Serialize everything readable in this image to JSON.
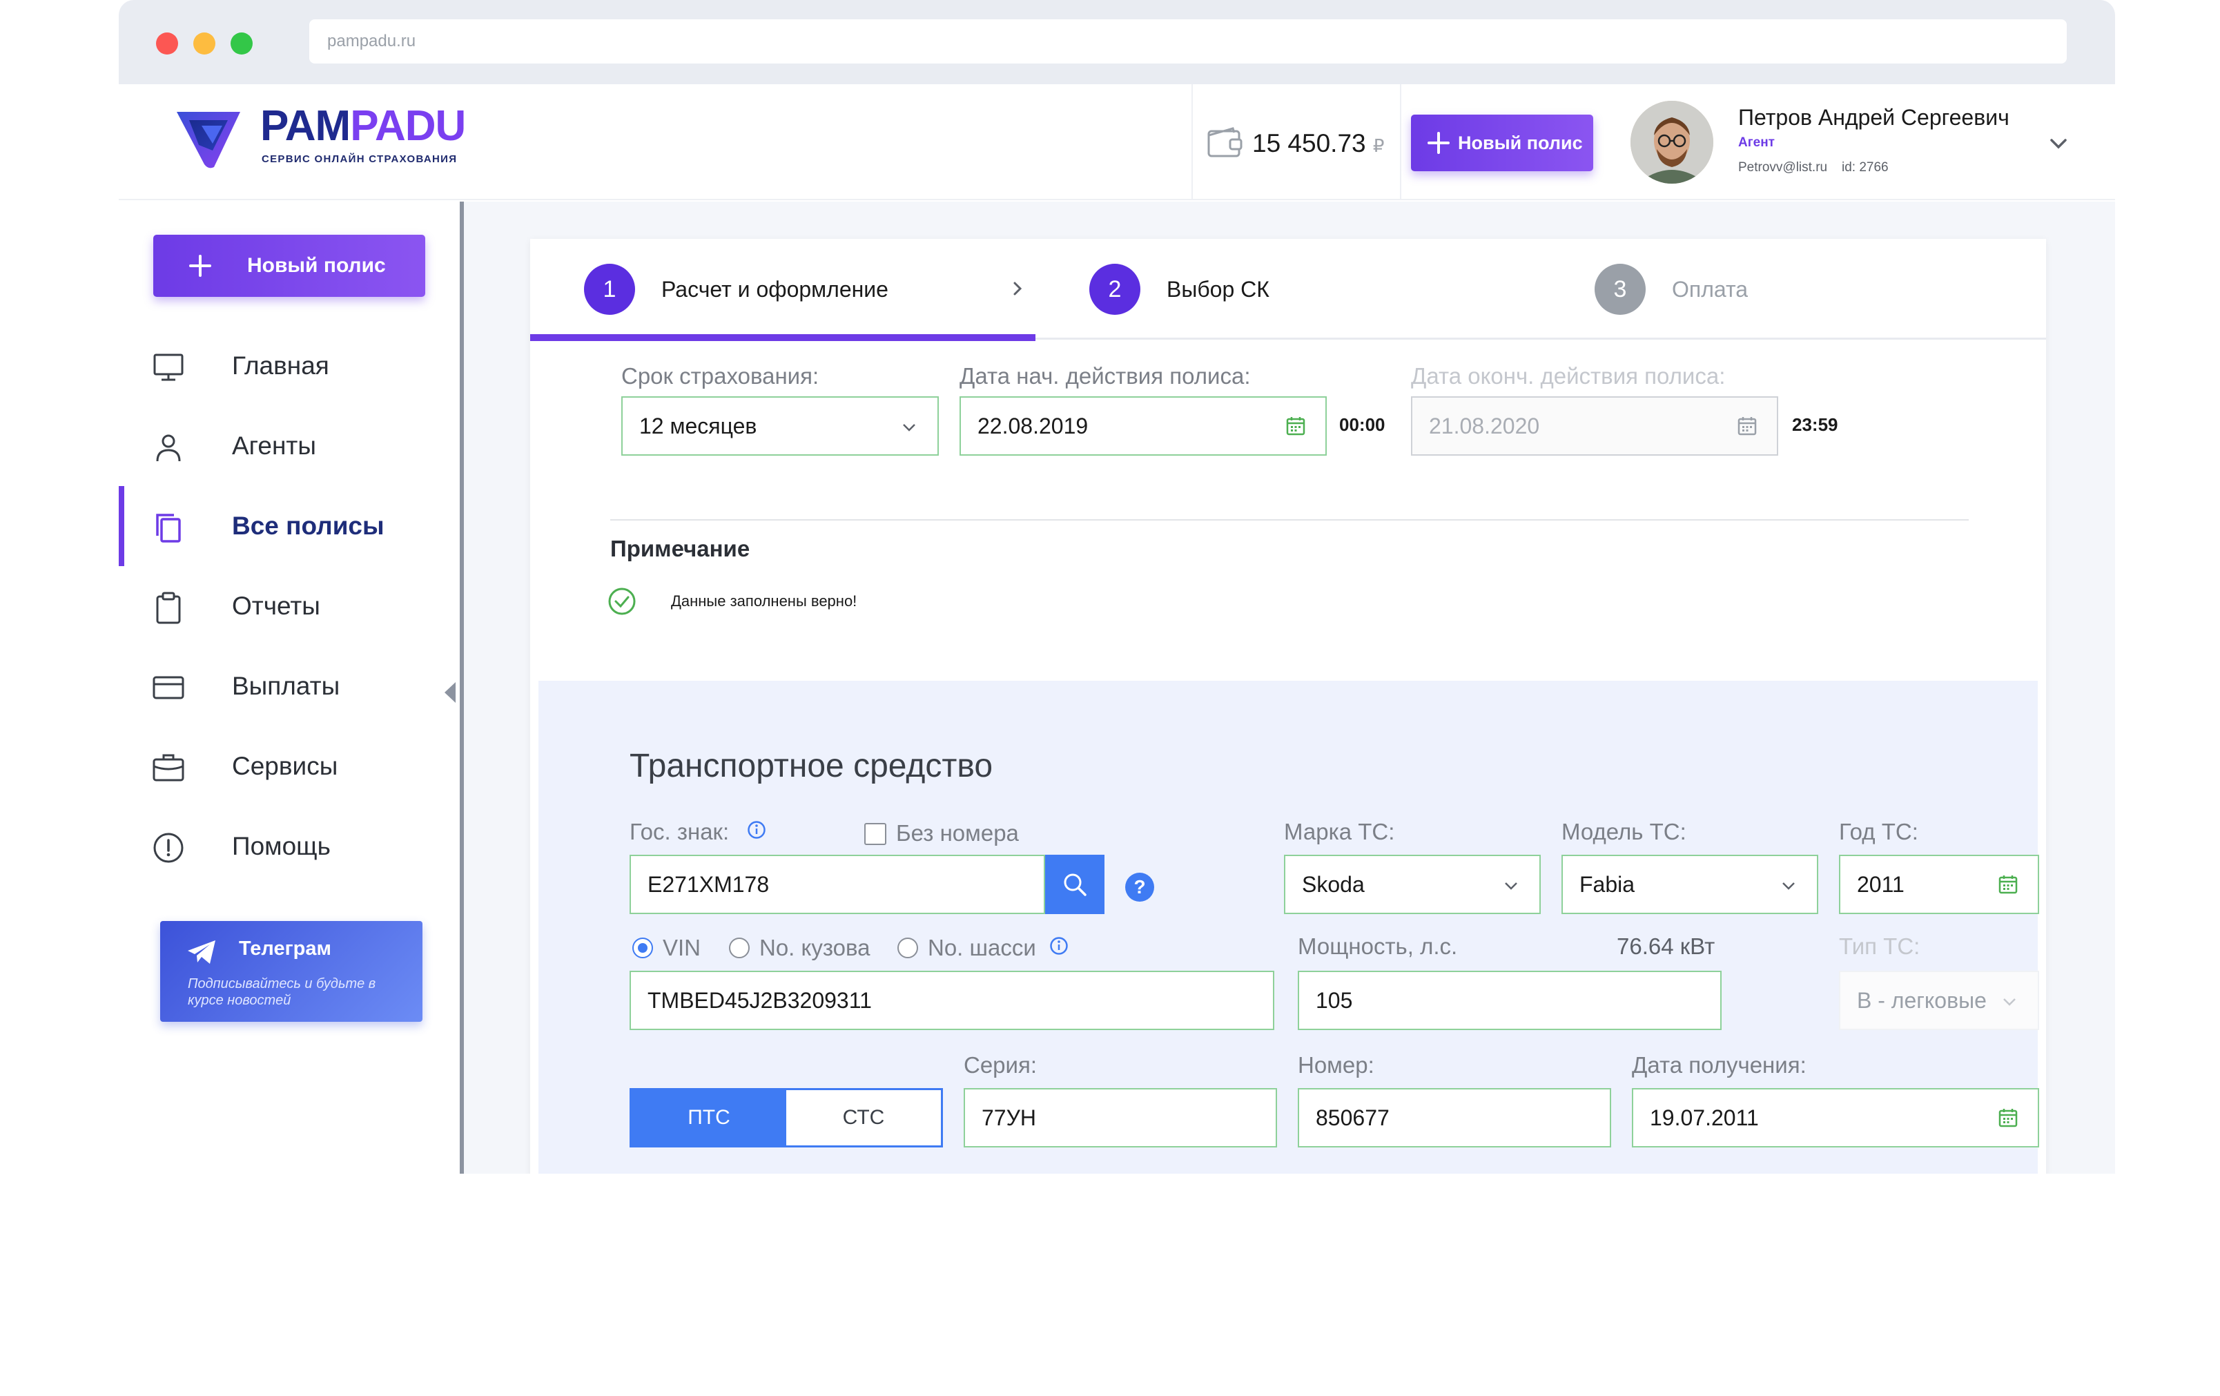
{
  "browser": {
    "url": "pampadu.ru"
  },
  "brand": {
    "name_part1": "PAM",
    "name_part2": "PADU",
    "tagline": "СЕРВИС ОНЛАЙН СТРАХОВАНИЯ",
    "color_dark": "#1f2a8f",
    "color_purple": "#7a3ff0"
  },
  "header": {
    "balance": "15 450.73",
    "currency": "₽",
    "new_policy_label": "Новый полис",
    "user": {
      "name": "Петров Андрей Сергеевич",
      "role": "Агент",
      "email": "Petrovv@list.ru",
      "id_label": "id: 2766"
    }
  },
  "sidebar": {
    "new_policy_label": "Новый полис",
    "items": [
      {
        "label": "Главная",
        "icon": "monitor-icon"
      },
      {
        "label": "Агенты",
        "icon": "user-icon"
      },
      {
        "label": "Все полисы",
        "icon": "copy-icon",
        "active": true
      },
      {
        "label": "Отчеты",
        "icon": "clipboard-icon"
      },
      {
        "label": "Выплаты",
        "icon": "card-icon"
      },
      {
        "label": "Сервисы",
        "icon": "briefcase-icon"
      },
      {
        "label": "Помощь",
        "icon": "alert-circle-icon"
      }
    ],
    "telegram": {
      "title": "Телеграм",
      "subtitle_line1": "Подписывайтесь и будьте в",
      "subtitle_line2": "курсе новостей"
    }
  },
  "steps": [
    {
      "num": "1",
      "label": "Расчет и оформление",
      "state": "active"
    },
    {
      "num": "2",
      "label": "Выбор СК",
      "state": "pending"
    },
    {
      "num": "3",
      "label": "Оплата",
      "state": "disabled"
    }
  ],
  "policy": {
    "term_label": "Срок страхования:",
    "term_value": "12 месяцев",
    "start_label": "Дата нач. действия полиса:",
    "start_value": "22.08.2019",
    "start_time": "00:00",
    "end_label": "Дата оконч. действия полиса:",
    "end_value": "21.08.2020",
    "end_time": "23:59"
  },
  "note": {
    "title": "Примечание",
    "message": "Данные заполнены верно!"
  },
  "vehicle": {
    "title": "Транспортное средство",
    "plate_label": "Гос. знак:",
    "plate_value": "Е271ХМ178",
    "no_plate_label": "Без номера",
    "brand_label": "Марка ТС:",
    "brand_value": "Skoda",
    "model_label": "Модель ТС:",
    "model_value": "Fabia",
    "year_label": "Год ТС:",
    "year_value": "2011",
    "id_types": [
      "VIN",
      "No. кузова",
      "No. шасси"
    ],
    "id_selected": "VIN",
    "vin_value": "TMBED45J2B3209311",
    "power_label": "Мощность, л.с.",
    "power_kw": "76.64 кВт",
    "power_value": "105",
    "type_label": "Тип ТС:",
    "type_value": "B - легковые",
    "doc_tabs": [
      "ПТС",
      "СТС"
    ],
    "doc_selected": "ПТС",
    "series_label": "Серия:",
    "series_value": "77УН",
    "number_label": "Номер:",
    "number_value": "850677",
    "date_label": "Дата получения:",
    "date_value": "19.07.2011"
  },
  "colors": {
    "accent": "#6d3be6",
    "blue": "#3f7bf3",
    "green": "#4caf50",
    "input_border": "#8ed19a"
  }
}
